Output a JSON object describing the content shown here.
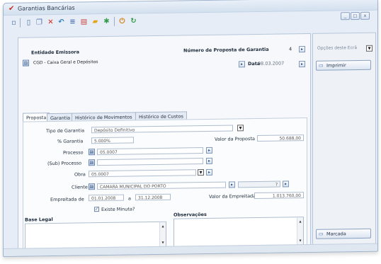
{
  "window": {
    "title": "Garantias Bancárias",
    "controls": {
      "minimize": "_",
      "maximize": "□",
      "close": "x"
    }
  },
  "toolbar": {
    "icons": [
      "new-icon",
      "copy-icon",
      "delete-icon",
      "undo-icon",
      "list-icon",
      "print-icon",
      "export-icon",
      "power-icon",
      "refresh-icon"
    ]
  },
  "header": {
    "entity_label": "Entidade Emissora",
    "entity_value": "CGD - Caixa Geral e Depósitos",
    "proposal_label": "Número de Proposta de Garantia",
    "proposal_value": "4",
    "date_label": "Data",
    "date_value": "08.03.2007"
  },
  "tabs": [
    {
      "label": "Proposta",
      "active": true
    },
    {
      "label": "Garantia",
      "active": false
    },
    {
      "label": "Histórico de Movimentos",
      "active": false
    },
    {
      "label": "Histórico de Custos",
      "active": false
    }
  ],
  "form": {
    "tipo_label": "Tipo de Garantia",
    "tipo_value": "Depósito Definitivo",
    "pct_label": "% Garantia",
    "pct_value": "5.000%",
    "valor_proposta_label": "Valor da Proposta",
    "valor_proposta_value": "50.688,00",
    "processo_label": "Processo",
    "processo_value": "05.0007",
    "subprocesso_label": "(Sub) Processo",
    "subprocesso_value": "",
    "obra_label": "Obra",
    "obra_value": "05.0007",
    "cliente_label": "Cliente",
    "cliente_value": "CAMARA MUNICIPAL DO PORTO",
    "cliente_code": "?",
    "empreitada_label": "Empreitada de",
    "empreitada_from": "01.01.2008",
    "empreitada_sep": "a",
    "empreitada_to": "31.12.2008",
    "valor_empreitada_label": "Valor da Empreitada",
    "valor_empreitada_value": "1.013.760,00",
    "minuta_label": "Existe Minuta?",
    "minuta_checked": true,
    "base_legal_label": "Base Legal",
    "observacoes_label": "Observações"
  },
  "sidebar": {
    "options_value": "Opções deste Ecrã",
    "imprimir_label": "Imprimir",
    "marcada_label": "Marcada"
  },
  "colors": {
    "accent": "#3a62a8",
    "delete_red": "#d22a1e",
    "window_bg": "#e6edf6"
  }
}
